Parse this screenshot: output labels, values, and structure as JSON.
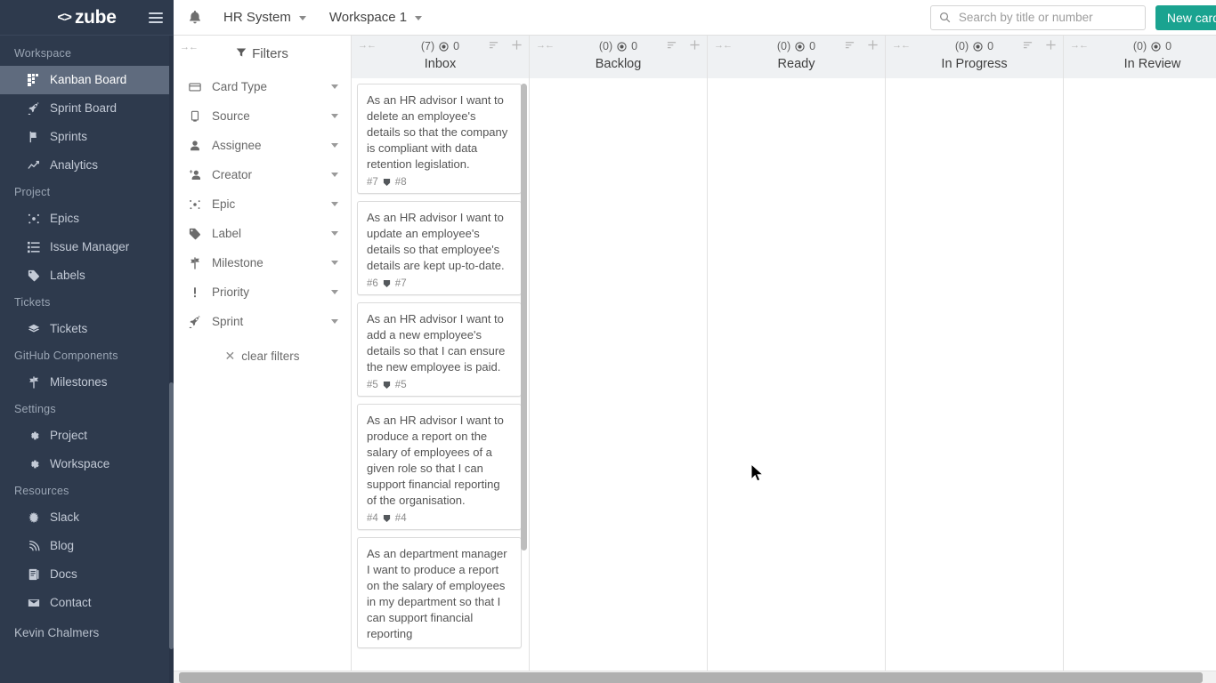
{
  "brand": {
    "mark": "<>",
    "name": "zube",
    "menu_icon": "hamburger-icon"
  },
  "sidebar": {
    "sections": [
      {
        "title": "Workspace",
        "items": [
          {
            "label": "Kanban Board",
            "icon": "kanban-icon",
            "active": true
          },
          {
            "label": "Sprint Board",
            "icon": "rocket-icon",
            "active": false
          },
          {
            "label": "Sprints",
            "icon": "flag-icon",
            "active": false
          },
          {
            "label": "Analytics",
            "icon": "chart-line-icon",
            "active": false
          }
        ]
      },
      {
        "title": "Project",
        "items": [
          {
            "label": "Epics",
            "icon": "epic-icon",
            "active": false
          },
          {
            "label": "Issue Manager",
            "icon": "list-icon",
            "active": false
          },
          {
            "label": "Labels",
            "icon": "tag-icon",
            "active": false
          }
        ]
      },
      {
        "title": "Tickets",
        "items": [
          {
            "label": "Tickets",
            "icon": "ticket-stack-icon",
            "active": false
          }
        ]
      },
      {
        "title": "GitHub Components",
        "items": [
          {
            "label": "Milestones",
            "icon": "milestone-icon",
            "active": false
          }
        ]
      },
      {
        "title": "Settings",
        "items": [
          {
            "label": "Project",
            "icon": "gear-icon",
            "active": false
          },
          {
            "label": "Workspace",
            "icon": "gear-icon",
            "active": false
          }
        ]
      },
      {
        "title": "Resources",
        "items": [
          {
            "label": "Slack",
            "icon": "slack-icon",
            "active": false
          },
          {
            "label": "Blog",
            "icon": "rss-icon",
            "active": false
          },
          {
            "label": "Docs",
            "icon": "docs-icon",
            "active": false
          },
          {
            "label": "Contact",
            "icon": "envelope-icon",
            "active": false
          }
        ]
      }
    ],
    "user": "Kevin Chalmers"
  },
  "topbar": {
    "bell_icon": "bell-icon",
    "project_name": "HR System",
    "workspace_name": "Workspace 1",
    "search": {
      "placeholder": "Search by title or number",
      "value": "",
      "icon": "search-icon"
    },
    "new_card_label": "New card"
  },
  "filters": {
    "title": "Filters",
    "title_icon": "funnel-icon",
    "collapse_icon": "collapse-arrows-icon",
    "rows": [
      {
        "label": "Card Type",
        "icon": "card-type-icon"
      },
      {
        "label": "Source",
        "icon": "source-icon"
      },
      {
        "label": "Assignee",
        "icon": "person-icon"
      },
      {
        "label": "Creator",
        "icon": "person-add-icon"
      },
      {
        "label": "Epic",
        "icon": "epic-icon"
      },
      {
        "label": "Label",
        "icon": "tag-icon"
      },
      {
        "label": "Milestone",
        "icon": "milestone-icon"
      },
      {
        "label": "Priority",
        "icon": "priority-icon"
      },
      {
        "label": "Sprint",
        "icon": "rocket-icon"
      }
    ],
    "clear_label": "clear filters"
  },
  "board": {
    "columns": [
      {
        "title": "Inbox",
        "count": "(7)",
        "points": "0",
        "cards": [
          {
            "title": "As an HR advisor I want to delete an employee's details so that the company is compliant with data retention legislation.",
            "number": "#7",
            "gh_number": "#8"
          },
          {
            "title": "As an HR advisor I want to update an employee's details so that employee's details are kept up-to-date.",
            "number": "#6",
            "gh_number": "#7"
          },
          {
            "title": "As an HR advisor I want to add a new employee's details so that I can ensure the new employee is paid.",
            "number": "#5",
            "gh_number": "#5"
          },
          {
            "title": "As an HR advisor I want to produce a report on the salary of employees of a given role so that I can support financial reporting of the organisation.",
            "number": "#4",
            "gh_number": "#4"
          },
          {
            "title": "As an department manager I want to produce a report on the salary of employees in my department so that I can support financial reporting",
            "number": "",
            "gh_number": ""
          }
        ]
      },
      {
        "title": "Backlog",
        "count": "(0)",
        "points": "0",
        "cards": []
      },
      {
        "title": "Ready",
        "count": "(0)",
        "points": "0",
        "cards": []
      },
      {
        "title": "In Progress",
        "count": "(0)",
        "points": "0",
        "cards": []
      },
      {
        "title": "In Review",
        "count": "(0)",
        "points": "0",
        "cards": []
      }
    ],
    "header_icons": {
      "points_icon": "target-icon",
      "sort_icon": "sort-icon",
      "add_icon": "plus-icon",
      "collapse_icon": "collapse-arrows-icon"
    }
  },
  "colors": {
    "sidebar_bg": "#2e3a4d",
    "sidebar_active": "#5f6b7e",
    "accent": "#1aa390",
    "column_header_bg": "#eff1f3"
  }
}
